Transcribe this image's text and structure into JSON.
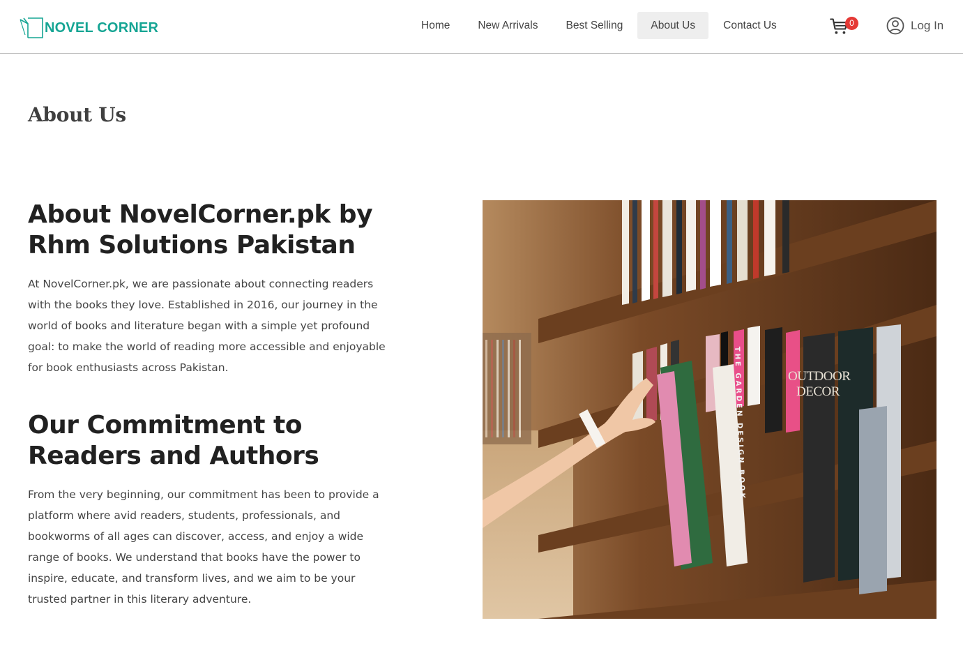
{
  "header": {
    "logo_text": "NOVEL CORNER",
    "nav": [
      {
        "label": "Home"
      },
      {
        "label": "New Arrivals"
      },
      {
        "label": "Best Selling"
      },
      {
        "label": "About Us",
        "active": true
      },
      {
        "label": "Contact Us"
      }
    ],
    "cart_count": "0",
    "login_label": "Log In"
  },
  "page": {
    "title": "About Us",
    "sections": [
      {
        "heading": "About NovelCorner.pk by Rhm Solutions Pakistan",
        "text": "At NovelCorner.pk, we are passionate about connecting readers with the books they love. Established in 2016, our journey in the world of books and literature began with a simple yet profound goal: to make the world of reading more accessible and enjoyable for book enthusiasts across Pakistan."
      },
      {
        "heading": "Our Commitment to Readers and Authors",
        "text": "From the very beginning, our commitment has been to provide a platform where avid readers, students, professionals, and bookworms of all ages can discover, access, and enjoy a wide range of books. We understand that books have the power to inspire, educate, and transform lives, and we aim to be your trusted partner in this literary adventure."
      }
    ],
    "image_text": {
      "book_spine": "THE GARDEN DESIGN BOOK",
      "book_cover_line1": "OUTDOOR",
      "book_cover_line2": "DECOR"
    }
  },
  "colors": {
    "brand": "#16a594",
    "badge": "#e53935",
    "active_nav_bg": "#eeeeee"
  },
  "icons": [
    "logo-icon",
    "cart-icon",
    "user-icon"
  ]
}
